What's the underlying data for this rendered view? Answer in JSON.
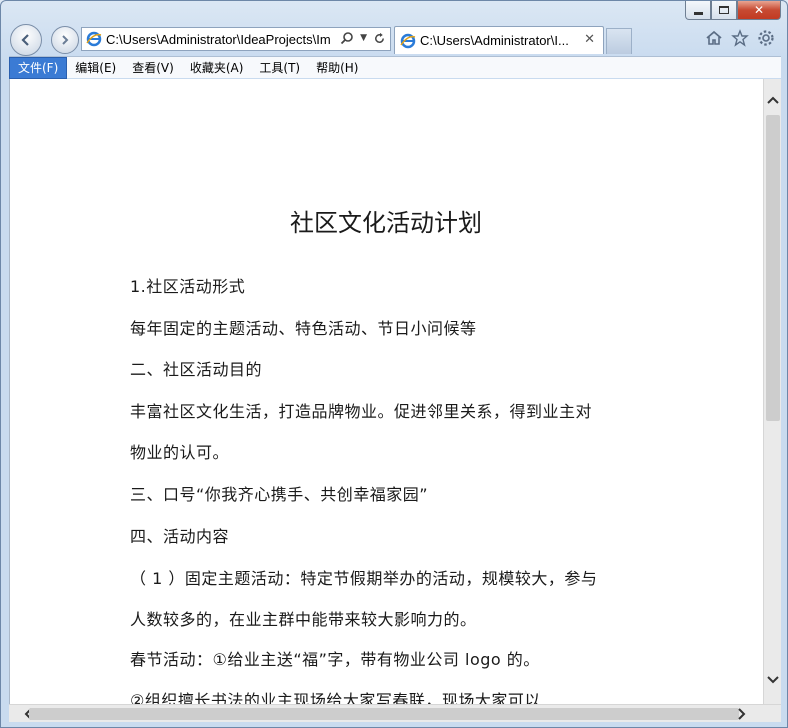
{
  "browser": {
    "address_text": "C:\\Users\\Administrator\\IdeaProjects\\Im",
    "tab_title": "C:\\Users\\Administrator\\I...",
    "icons": {
      "back": "back-arrow-icon",
      "forward": "forward-arrow-icon",
      "search": "search-icon",
      "refresh": "refresh-icon",
      "home": "home-icon",
      "favorites": "star-icon",
      "tools": "gear-icon"
    }
  },
  "menu": {
    "items": [
      "文件(F)",
      "编辑(E)",
      "查看(V)",
      "收藏夹(A)",
      "工具(T)",
      "帮助(H)"
    ]
  },
  "document": {
    "title": "社区文化活动计划",
    "lines": [
      "1.社区活动形式",
      "  每年固定的主题活动、特色活动、节日小问候等",
      "二、社区活动目的",
      "  丰富社区文化生活，打造品牌物业。促进邻里关系，得到业主对",
      "物业的认可。",
      "三、口号“你我齐心携手、共创幸福家园”",
      "四、活动内容",
      "  （ 1 ）固定主题活动：特定节假期举办的活动，规模较大，参与",
      "人数较多的，在业主群中能带来较大影响力的。",
      "春节活动：①给业主送“福”字，带有物业公司 logo 的。",
      "        ②组织擅长书法的业主现场给大家写春联，现场大家可以"
    ]
  },
  "colors": {
    "menu_active": "#3b7bd4",
    "close_button": "#c74a32"
  }
}
